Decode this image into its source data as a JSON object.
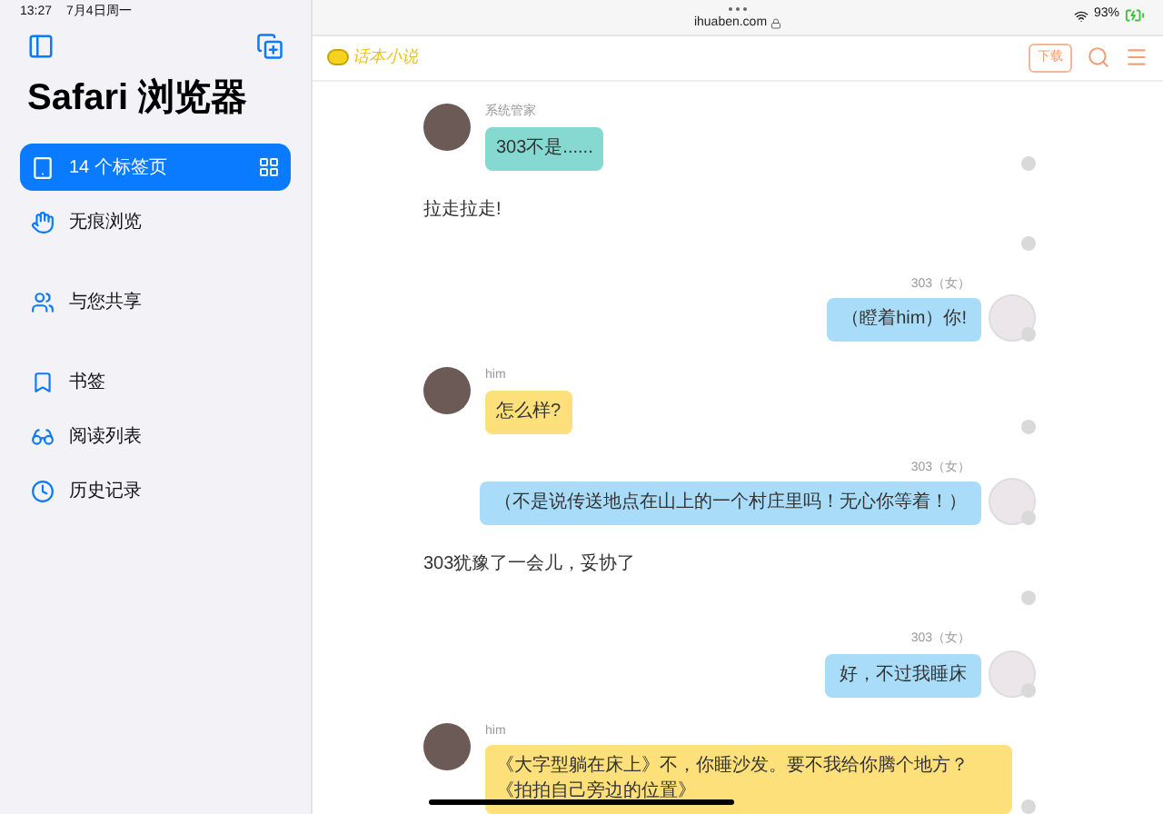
{
  "status_bar": {
    "time": "13:27",
    "date": "7月4日周一",
    "battery": "93%"
  },
  "sidebar": {
    "title": "Safari 浏览器",
    "groups": [
      [
        {
          "label": "14 个标签页",
          "selected": true
        },
        {
          "label": "无痕浏览",
          "selected": false
        }
      ],
      [
        {
          "label": "与您共享",
          "selected": false
        }
      ],
      [
        {
          "label": "书签",
          "selected": false
        },
        {
          "label": "阅读列表",
          "selected": false
        },
        {
          "label": "历史记录",
          "selected": false
        }
      ]
    ]
  },
  "address_bar": {
    "url": "ihuaben.com"
  },
  "site_header": {
    "logo": "话本小说",
    "download_button": "下载"
  },
  "chat": [
    {
      "kind": "left",
      "name": "系统管家",
      "text": "303不是......",
      "color": "#86d9d0"
    },
    {
      "kind": "narration",
      "text": "拉走拉走!"
    },
    {
      "kind": "right",
      "name": "303（女）",
      "text": "（瞪着him）你!",
      "color": "#a9dcf8"
    },
    {
      "kind": "left",
      "name": "him",
      "text": "怎么样?",
      "color": "#fde07a"
    },
    {
      "kind": "right",
      "name": "303（女）",
      "text": "（不是说传送地点在山上的一个村庄里吗！无心你等着！）",
      "color": "#a9dcf8"
    },
    {
      "kind": "narration",
      "text": "303犹豫了一会儿，妥协了"
    },
    {
      "kind": "right",
      "name": "303（女）",
      "text": "好，不过我睡床",
      "color": "#a9dcf8"
    },
    {
      "kind": "left",
      "name": "him",
      "text": "《大字型躺在床上》不，你睡沙发。要不我给你腾个地方？《拍拍自己旁边的位置》",
      "color": "#fde07a"
    }
  ]
}
